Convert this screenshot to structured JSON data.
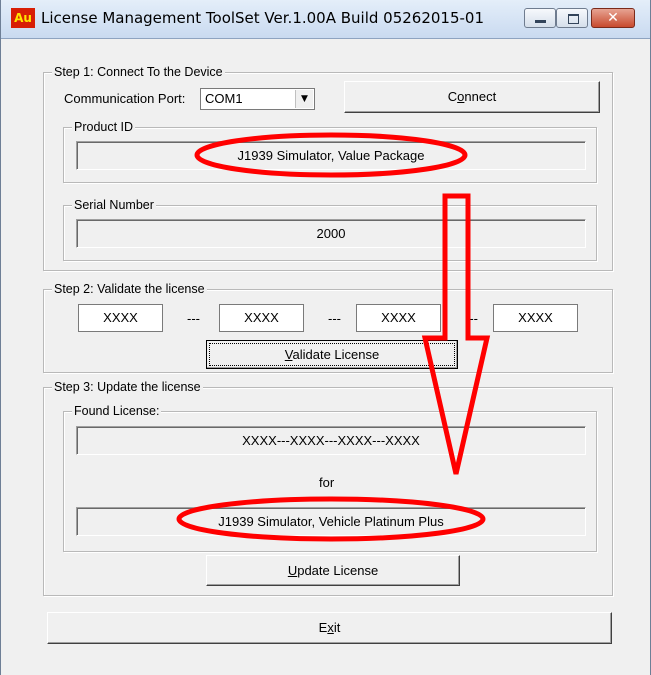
{
  "window": {
    "app_icon_text": "Au",
    "title": "License Management ToolSet Ver.1.00A Build 05262015-01",
    "controls": {
      "minimize": "minimize",
      "maximize": "maximize",
      "close": "✕"
    }
  },
  "step1": {
    "legend": "Step 1: Connect To the Device",
    "port_label": "Communication Port:",
    "port_value": "COM1",
    "connect_label_pre": "C",
    "connect_label_u": "o",
    "connect_label_post": "nnect",
    "product_id_legend": "Product ID",
    "product_id_value": "J1939 Simulator, Value Package",
    "serial_legend": "Serial Number",
    "serial_value": "2000"
  },
  "step2": {
    "legend": "Step 2: Validate the license",
    "key_parts": [
      "XXXX",
      "XXXX",
      "XXXX",
      "XXXX"
    ],
    "separator": "---",
    "validate_u": "V",
    "validate_post": "alidate License"
  },
  "step3": {
    "legend": "Step 3: Update the license",
    "found_legend": "Found License:",
    "found_value": "XXXX---XXXX---XXXX---XXXX",
    "for_text": "for",
    "target_value": "J1939 Simulator, Vehicle Platinum Plus",
    "update_u": "U",
    "update_post": "pdate License"
  },
  "exit": {
    "pre": "E",
    "u": "x",
    "post": "it"
  },
  "annotation_color": "#ff0000"
}
